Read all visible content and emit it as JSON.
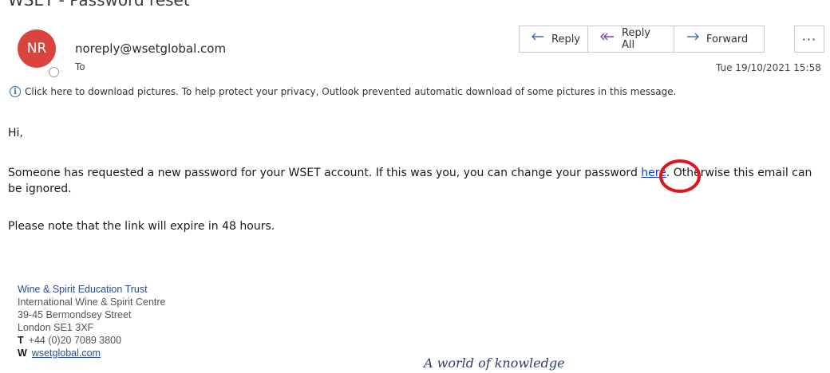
{
  "email": {
    "subject": "WSET - Password reset",
    "avatar_initials": "NR",
    "sender": "noreply@wsetglobal.com",
    "to_label": "To",
    "date": "Tue 19/10/2021 15:58"
  },
  "actions": {
    "reply": "Reply",
    "reply_all": "Reply All",
    "forward": "Forward",
    "more": "···"
  },
  "info_bar": {
    "text": "Click here to download pictures. To help protect your privacy, Outlook prevented automatic download of some pictures in this message."
  },
  "body": {
    "greeting": "Hi,",
    "para1_before": "Someone has requested a new password for your WSET account. If this was you, you can change your password ",
    "para1_link": "here",
    "para1_after": ". Otherwise this email can be ignored.",
    "para2": "Please note that the link will expire in 48 hours."
  },
  "signature": {
    "org": "Wine & Spirit Education Trust",
    "line1": "International Wine & Spirit Centre",
    "line2": "39-45 Bermondsey Street",
    "line3": "London SE1 3XF",
    "t_label": "T",
    "phone": "+44 (0)20 7089 3800",
    "w_label": "W",
    "website": "wsetglobal.com",
    "tagline": "A world of knowledge"
  },
  "colors": {
    "avatar": "#d9443f",
    "link": "#0b3ed6",
    "annotation": "#e0141c",
    "signature_org": "#2a4d8f"
  }
}
